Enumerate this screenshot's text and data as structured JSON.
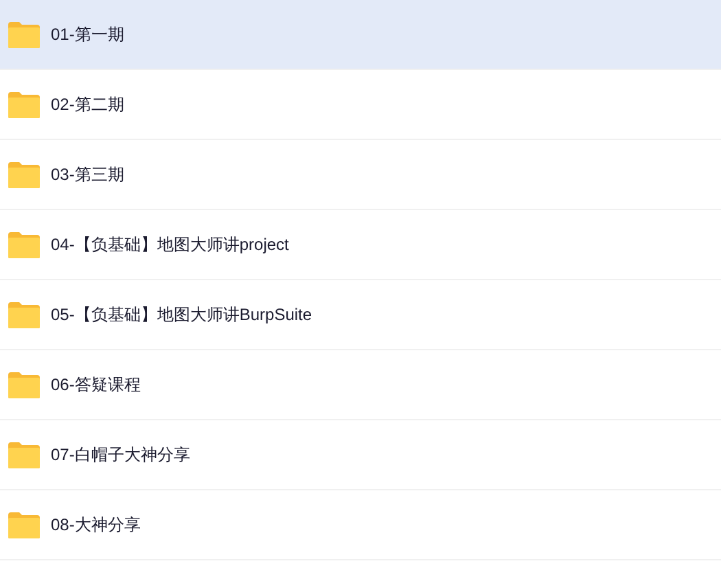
{
  "folders": [
    {
      "name": "01-第一期",
      "selected": true
    },
    {
      "name": "02-第二期",
      "selected": false
    },
    {
      "name": "03-第三期",
      "selected": false
    },
    {
      "name": "04-【负基础】地图大师讲project",
      "selected": false
    },
    {
      "name": "05-【负基础】地图大师讲BurpSuite",
      "selected": false
    },
    {
      "name": "06-答疑课程",
      "selected": false
    },
    {
      "name": "07-白帽子大神分享",
      "selected": false
    },
    {
      "name": "08-大神分享",
      "selected": false
    }
  ]
}
